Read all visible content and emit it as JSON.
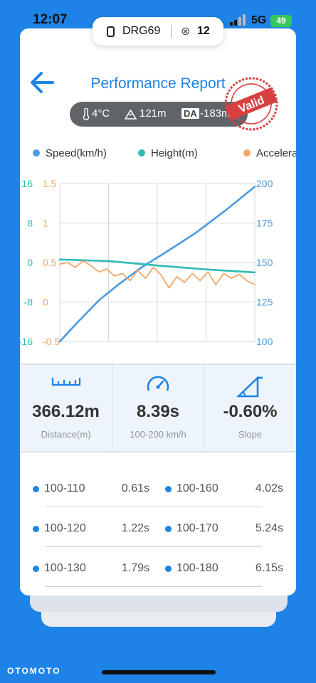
{
  "status_bar": {
    "time": "12:07",
    "network": "5G",
    "battery": "49"
  },
  "vehicle_pill": {
    "plate": "DRG69",
    "count": "12"
  },
  "header": {
    "title": "Performance Report",
    "stamp_text": "Valid"
  },
  "conditions": {
    "temperature": "4°C",
    "altitude": "121m",
    "da_label": "DA",
    "density_altitude": "-183m"
  },
  "colors": {
    "speed": "#4a9be0",
    "height": "#2dbbb6",
    "acceleration": "#f2a768",
    "accent": "#1e83e6"
  },
  "chart_data": {
    "type": "line",
    "series_names": [
      "Speed(km/h)",
      "Height(m)",
      "Acceleration"
    ],
    "left_axis_height": {
      "ticks": [
        "16",
        "8",
        "0",
        "-8",
        "-16"
      ],
      "range": [
        -16,
        16
      ],
      "color": "#2dbbb6"
    },
    "left_axis_accel": {
      "ticks": [
        "1.5",
        "1",
        "0.5",
        "0",
        "-0.5"
      ],
      "range": [
        -0.5,
        1.5
      ],
      "color": "#f2a768"
    },
    "right_axis_speed": {
      "ticks": [
        "200",
        "175",
        "150",
        "125",
        "100"
      ],
      "range": [
        100,
        200
      ],
      "color": "#4a9be0"
    },
    "grid": true,
    "series": [
      {
        "name": "Speed(km/h)",
        "axis": "right",
        "t": [
          0,
          0.09,
          0.2,
          0.3,
          0.42,
          0.55,
          0.7,
          0.85,
          1.0
        ],
        "values": [
          100,
          112,
          126,
          136,
          147,
          157,
          169,
          183,
          198
        ]
      },
      {
        "name": "Height(m)",
        "axis": "left",
        "t": [
          0,
          0.25,
          0.5,
          0.75,
          1.0
        ],
        "values": [
          0.6,
          0.3,
          -0.6,
          -1.4,
          -2.0
        ]
      },
      {
        "name": "Acceleration",
        "axis": "left2",
        "t": [
          0,
          0.04,
          0.08,
          0.12,
          0.16,
          0.2,
          0.24,
          0.28,
          0.32,
          0.36,
          0.4,
          0.44,
          0.48,
          0.52,
          0.56,
          0.6,
          0.64,
          0.68,
          0.72,
          0.76,
          0.8,
          0.84,
          0.88,
          0.92,
          0.96,
          1.0
        ],
        "values": [
          0.48,
          0.5,
          0.44,
          0.52,
          0.46,
          0.38,
          0.42,
          0.33,
          0.36,
          0.27,
          0.4,
          0.3,
          0.44,
          0.34,
          0.18,
          0.32,
          0.25,
          0.36,
          0.27,
          0.38,
          0.22,
          0.36,
          0.3,
          0.35,
          0.27,
          0.22
        ]
      }
    ]
  },
  "stats": [
    {
      "icon": "ruler-icon",
      "value": "366.12m",
      "label": "Distance(m)"
    },
    {
      "icon": "speedometer-icon",
      "value": "8.39s",
      "label": "100-200 km/h"
    },
    {
      "icon": "slope-icon",
      "value": "-0.60%",
      "label": "Slope"
    }
  ],
  "splits": [
    {
      "left_label": "100-110",
      "left_value": "0.61s",
      "right_label": "100-160",
      "right_value": "4.02s"
    },
    {
      "left_label": "100-120",
      "left_value": "1.22s",
      "right_label": "100-170",
      "right_value": "5.24s"
    },
    {
      "left_label": "100-130",
      "left_value": "1.79s",
      "right_label": "100-180",
      "right_value": "6.15s"
    }
  ],
  "watermark": "OTOMOTO"
}
